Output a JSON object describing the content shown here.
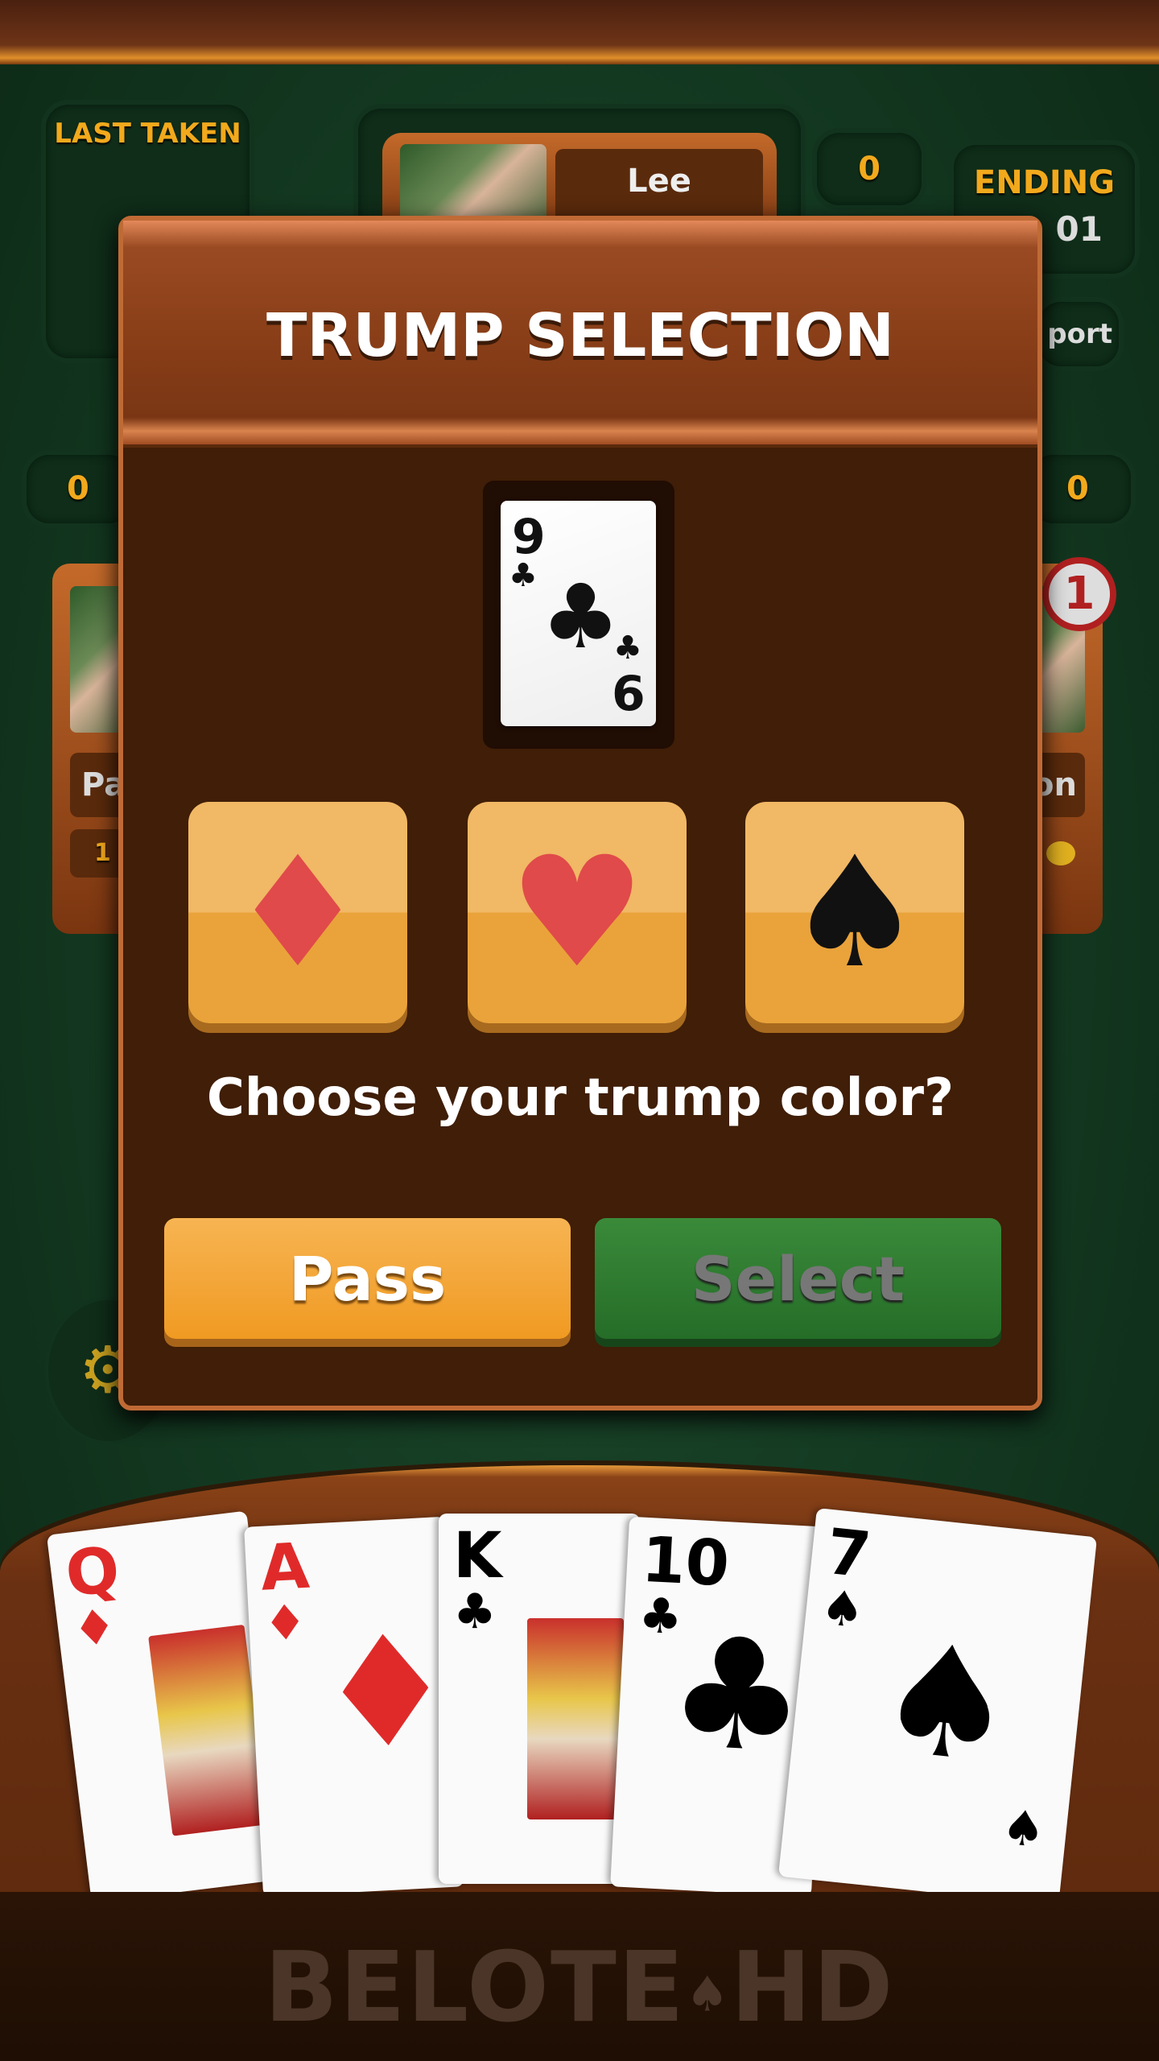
{
  "top": {
    "last_taken_label": "LAST TAKEN",
    "top_player": {
      "name": "Lee",
      "score": "0"
    },
    "ending": {
      "label": "ENDING",
      "value": "01"
    },
    "report_label": "port"
  },
  "left_player": {
    "name": "Pa",
    "score": "0",
    "coins": "1"
  },
  "right_player": {
    "name": "on",
    "score": "0",
    "badge": "1"
  },
  "dialog": {
    "title": "TRUMP SELECTION",
    "proposed_card": {
      "rank": "9",
      "rank_bottom": "6",
      "suit": "♣"
    },
    "suits": [
      {
        "name": "diamonds",
        "glyph": "♦",
        "color": "#e04a4a"
      },
      {
        "name": "hearts",
        "glyph": "♥",
        "color": "#e04a4a"
      },
      {
        "name": "spades",
        "glyph": "♠",
        "color": "#111111"
      }
    ],
    "question": "Choose your trump color?",
    "pass_label": "Pass",
    "select_label": "Select"
  },
  "hand": [
    {
      "rank": "Q",
      "suit": "♦",
      "color": "#e02a2a"
    },
    {
      "rank": "A",
      "suit": "♦",
      "color": "#e02a2a"
    },
    {
      "rank": "K",
      "suit": "♣",
      "color": "#111111"
    },
    {
      "rank": "10",
      "suit": "♣",
      "color": "#111111"
    },
    {
      "rank": "7",
      "suit": "♠",
      "color": "#111111"
    }
  ],
  "logo": {
    "text_left": "BELOTE",
    "text_right": "HD",
    "glyph": "♠"
  }
}
